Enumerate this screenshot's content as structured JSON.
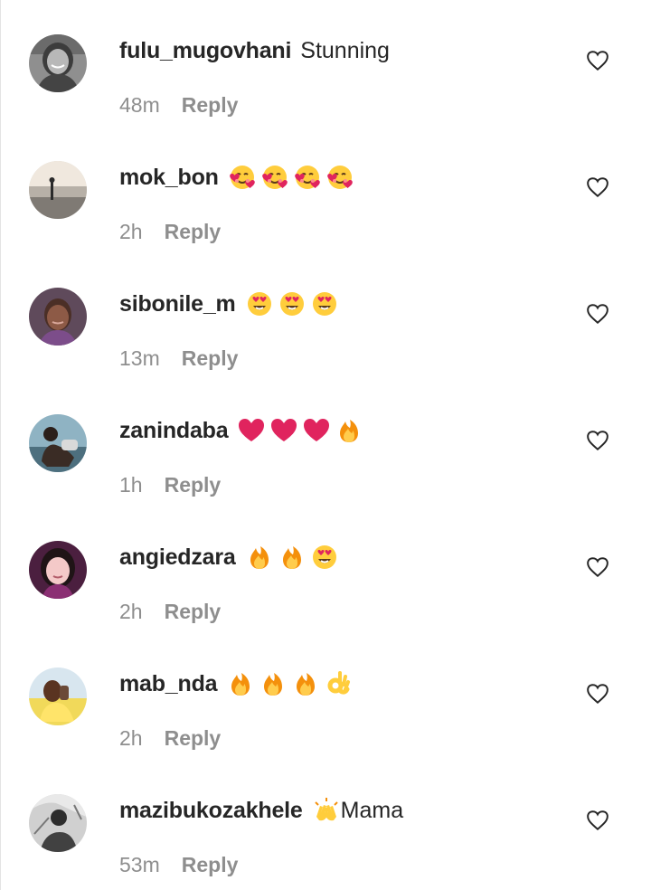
{
  "comments": [
    {
      "username": "fulu_mugovhani",
      "text": "Stunning",
      "emojis": [],
      "time": "48m",
      "reply_label": "Reply"
    },
    {
      "username": "mok_bon",
      "text": "",
      "emojis": [
        "smiling-face-with-hearts",
        "smiling-face-with-hearts",
        "smiling-face-with-hearts",
        "smiling-face-with-hearts"
      ],
      "time": "2h",
      "reply_label": "Reply"
    },
    {
      "username": "sibonile_m",
      "text": "",
      "emojis": [
        "heart-eyes-face",
        "heart-eyes-face",
        "heart-eyes-face"
      ],
      "time": "13m",
      "reply_label": "Reply"
    },
    {
      "username": "zanindaba",
      "text": "",
      "emojis": [
        "red-heart",
        "red-heart",
        "red-heart",
        "fire"
      ],
      "time": "1h",
      "reply_label": "Reply"
    },
    {
      "username": "angiedzara",
      "text": "",
      "emojis": [
        "fire",
        "fire",
        "heart-eyes-face"
      ],
      "time": "2h",
      "reply_label": "Reply"
    },
    {
      "username": "mab_nda",
      "text": "",
      "emojis": [
        "fire",
        "fire",
        "fire",
        "ok-hand"
      ],
      "time": "2h",
      "reply_label": "Reply"
    },
    {
      "username": "mazibukozakhele",
      "text": "Mama",
      "emojis": [
        "raising-hands"
      ],
      "emoji_before_text": true,
      "time": "53m",
      "reply_label": "Reply"
    }
  ],
  "colors": {
    "username": "#262626",
    "meta": "#8e8e8e",
    "background": "#ffffff"
  }
}
